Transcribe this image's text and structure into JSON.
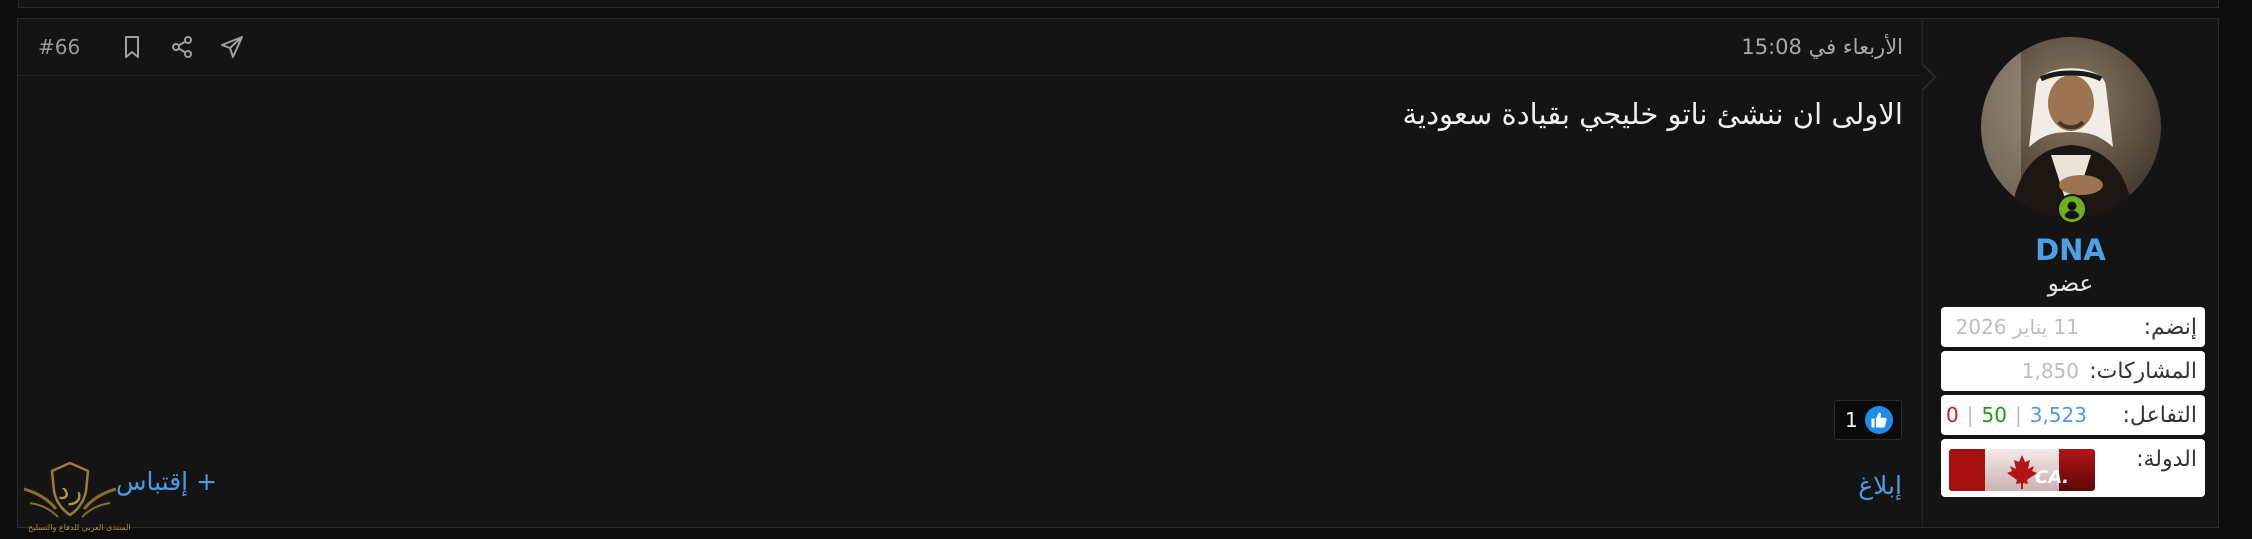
{
  "post": {
    "number": "#66",
    "date": "الأربعاء في 15:08",
    "message": "الاولى ان ننشئ ناتو خليجي بقيادة سعودية",
    "reaction_count": "1",
    "report_label": "إبلاغ",
    "quote_label": "+ إقتباس",
    "header_icons": [
      "bookmark-icon",
      "share-icon",
      "send-icon"
    ]
  },
  "user": {
    "name": "DNA",
    "title": "عضو",
    "status": "online",
    "stats": {
      "joined_label": "إنضم:",
      "joined_value": "11 يناير 2026",
      "posts_label": "المشاركات:",
      "posts_value": "1,850",
      "reactions_label": "التفاعل:",
      "reactions_value": "3,523",
      "positive": "50",
      "negative": "0",
      "separator": "|",
      "country_label": "الدولة:",
      "country_tld": ".CA"
    }
  },
  "watermark": {
    "caption": "المنتدى العربي للدفاع والتسليح"
  },
  "colors": {
    "background": "#141414",
    "link": "#4b9be8",
    "username": "#4ea0e6",
    "like": "#1e8ce8",
    "online": "#6fb01c",
    "reactions_value": "#4b9be8",
    "positive": "#1e9a1e",
    "negative": "#c81e1e"
  }
}
